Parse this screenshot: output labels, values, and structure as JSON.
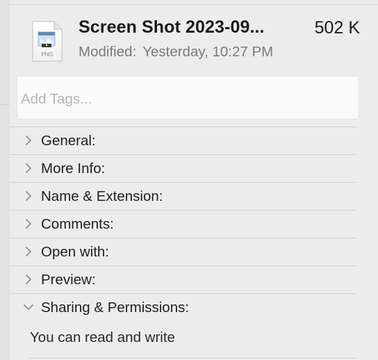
{
  "file": {
    "name": "Screen Shot 2023-09...",
    "size": "502 K",
    "modified_label": "Modified:",
    "modified_value": "Yesterday, 10:27 PM",
    "icon_label": "PNG"
  },
  "tags": {
    "placeholder": "Add Tags..."
  },
  "sections": [
    {
      "label": "General:",
      "expanded": false
    },
    {
      "label": "More Info:",
      "expanded": false
    },
    {
      "label": "Name & Extension:",
      "expanded": false
    },
    {
      "label": "Comments:",
      "expanded": false
    },
    {
      "label": "Open with:",
      "expanded": false
    },
    {
      "label": "Preview:",
      "expanded": false
    },
    {
      "label": "Sharing & Permissions:",
      "expanded": true
    }
  ],
  "permissions": {
    "summary": "You can read and write"
  }
}
